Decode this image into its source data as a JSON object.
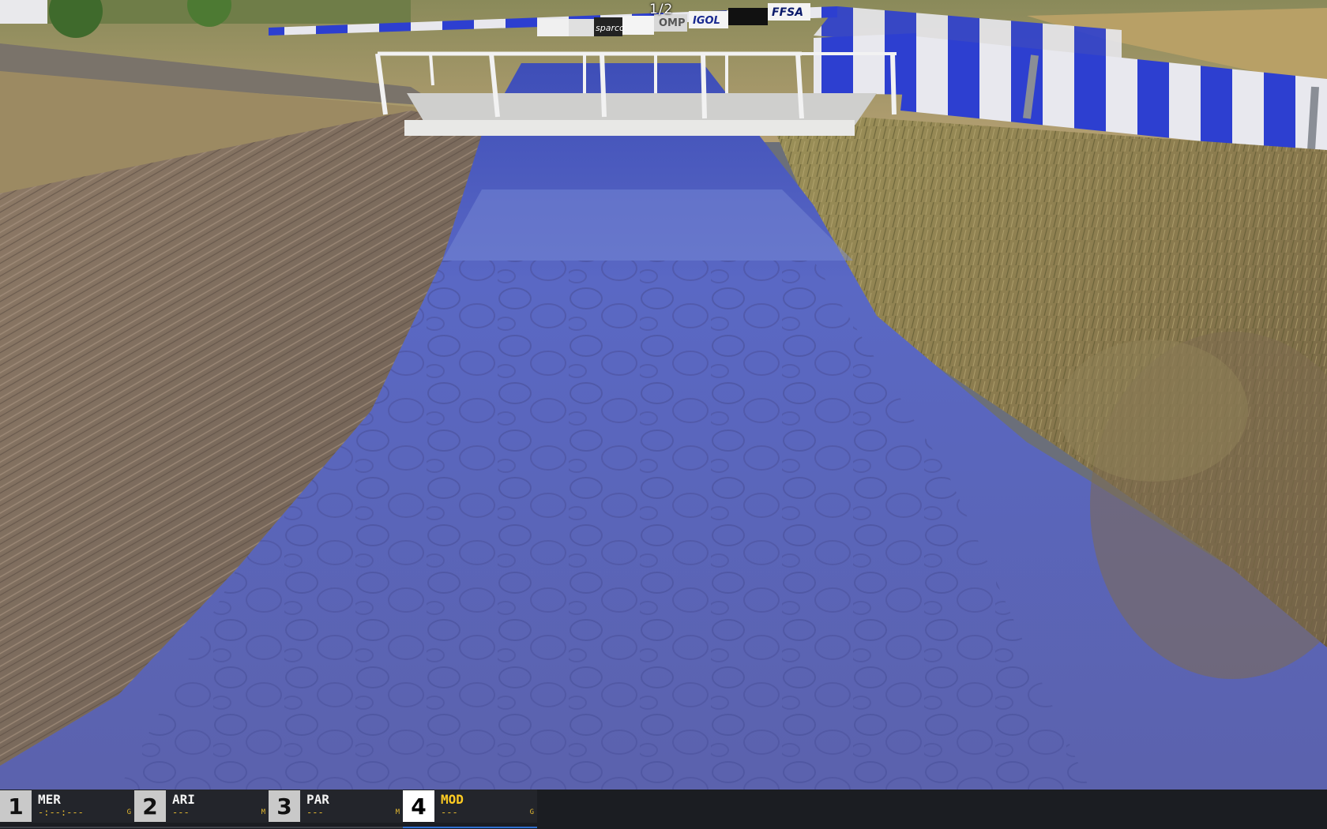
{
  "lap_counter": "1/2",
  "sponsors": [
    "sparco",
    "OMP",
    "IGOL",
    "FFSA"
  ],
  "hud": {
    "drivers": [
      {
        "position": "1",
        "name": "MER",
        "time": "-:--:---",
        "tag": "G",
        "active": false
      },
      {
        "position": "2",
        "name": "ARI",
        "time": "---",
        "tag": "M",
        "active": false
      },
      {
        "position": "3",
        "name": "PAR",
        "time": "---",
        "tag": "M",
        "active": false
      },
      {
        "position": "4",
        "name": "MOD",
        "time": "---",
        "tag": "G",
        "active": true
      }
    ]
  },
  "colors": {
    "water": "#5b65b8",
    "barrier_blue": "#2d3fd0",
    "hud_background": "#1b1d22",
    "active_name": "#ffcc22"
  }
}
